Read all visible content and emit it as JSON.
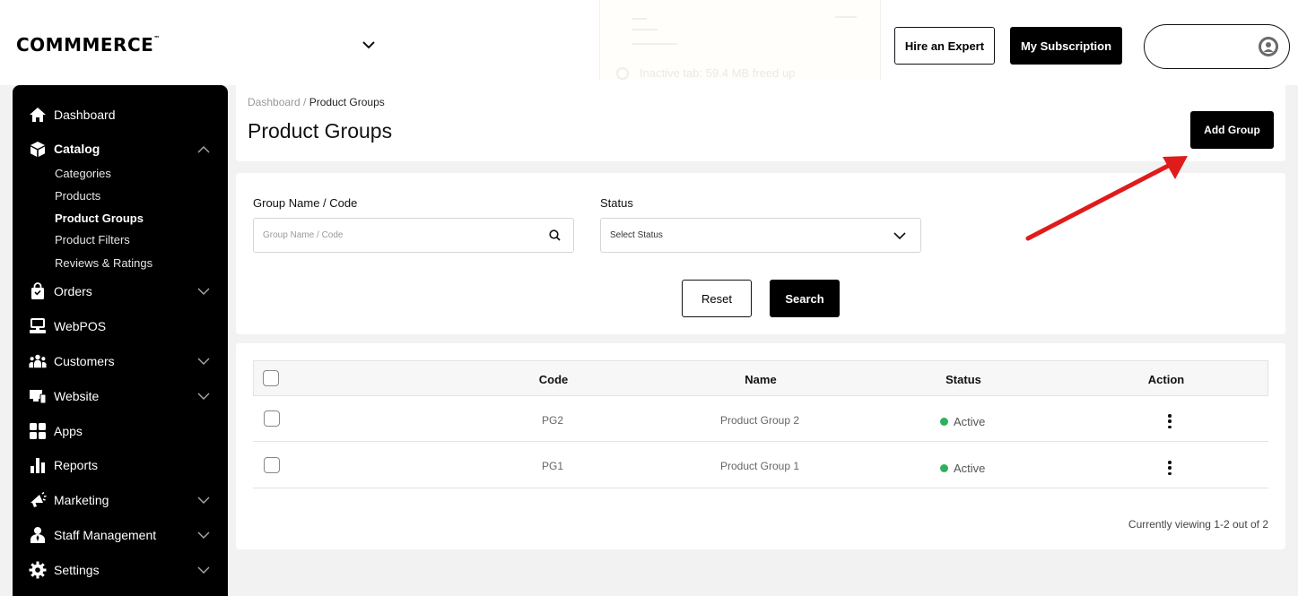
{
  "brand": {
    "logo": "COMMMERCE",
    "tm": "™"
  },
  "background_tab": {
    "text": "Inactive tab: 59.4 MB freed up"
  },
  "header": {
    "hire_label": "Hire an Expert",
    "subscription_label": "My Subscription"
  },
  "sidebar": {
    "items": [
      {
        "label": "Dashboard",
        "icon": "home-icon"
      },
      {
        "label": "Catalog",
        "icon": "box-icon",
        "expanded": true
      },
      {
        "label": "Orders",
        "icon": "shopping-bag-icon"
      },
      {
        "label": "WebPOS",
        "icon": "pos-terminal-icon"
      },
      {
        "label": "Customers",
        "icon": "users-icon"
      },
      {
        "label": "Website",
        "icon": "monitor-icon"
      },
      {
        "label": "Apps",
        "icon": "apps-grid-icon"
      },
      {
        "label": "Reports",
        "icon": "bar-chart-icon"
      },
      {
        "label": "Marketing",
        "icon": "megaphone-icon"
      },
      {
        "label": "Staff Management",
        "icon": "staff-icon"
      },
      {
        "label": "Settings",
        "icon": "gear-icon"
      }
    ],
    "catalog_sub": [
      "Categories",
      "Products",
      "Product Groups",
      "Product Filters",
      "Reviews & Ratings"
    ]
  },
  "breadcrumb": {
    "parent": "Dashboard",
    "separator": " / ",
    "current": "Product Groups"
  },
  "page_title": "Product Groups",
  "add_group_label": "Add Group",
  "filters": {
    "name_label": "Group Name / Code",
    "name_placeholder": "Group Name / Code",
    "status_label": "Status",
    "status_value": "Select Status",
    "reset_label": "Reset",
    "search_label": "Search"
  },
  "table": {
    "columns": [
      "Code",
      "Name",
      "Status",
      "Action"
    ],
    "rows": [
      {
        "code": "PG2",
        "name": "Product Group 2",
        "status": "Active"
      },
      {
        "code": "PG1",
        "name": "Product Group 1",
        "status": "Active"
      }
    ]
  },
  "pagination": {
    "text": "Currently viewing 1-2 out of 2"
  },
  "colors": {
    "active_dot": "#2eb15a",
    "annotation_arrow": "#e01b1b",
    "sidebar_bg": "#000000"
  }
}
